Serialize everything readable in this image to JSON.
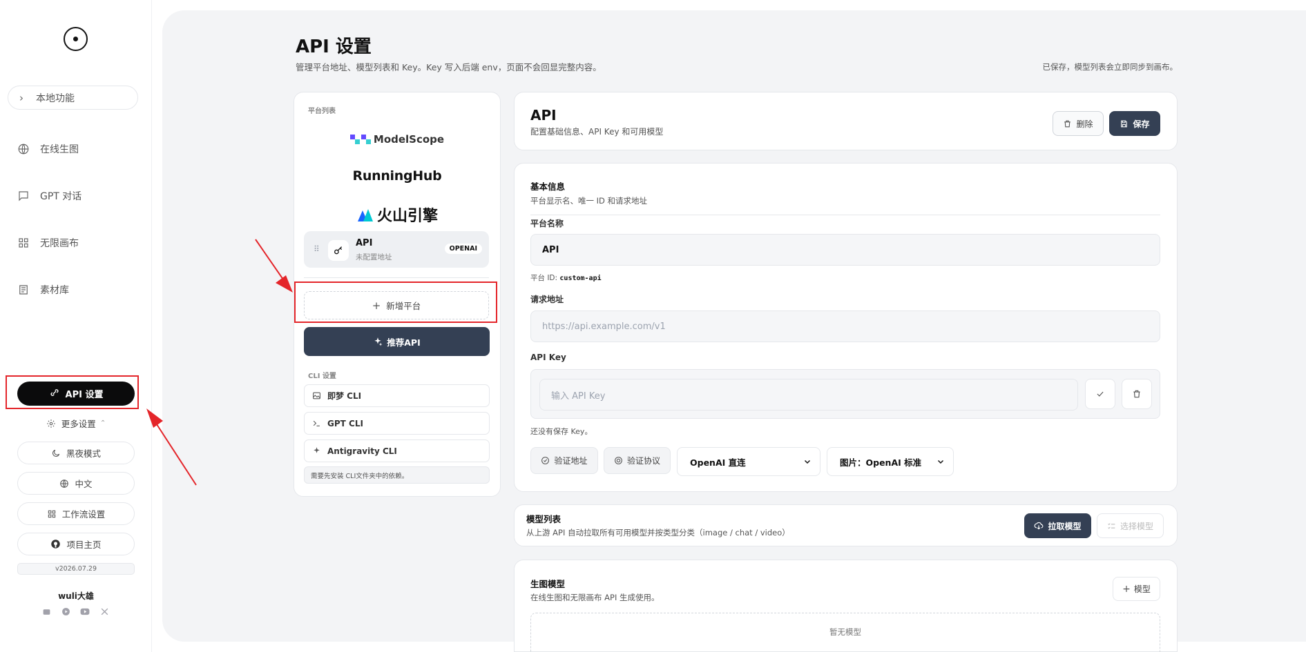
{
  "sidebar": {
    "local_func": "本地功能",
    "nav": [
      {
        "label": "在线生图",
        "icon": "globe-icon"
      },
      {
        "label": "GPT 对话",
        "icon": "chat-icon"
      },
      {
        "label": "无限画布",
        "icon": "grid-icon"
      },
      {
        "label": "素材库",
        "icon": "library-icon"
      }
    ],
    "api_settings": "API 设置",
    "more_settings": "更多设置",
    "dark_mode": "黑夜模式",
    "language": "中文",
    "workflow_settings": "工作流设置",
    "project_home": "项目主页",
    "version": "v2026.07.29",
    "author": "wuli大雄"
  },
  "page": {
    "title": "API 设置",
    "subtitle": "管理平台地址、模型列表和 Key。Key 写入后端 env，页面不会回显完整内容。",
    "saved_note": "已保存，模型列表会立即同步到画布。"
  },
  "platforms": {
    "section_label": "平台列表",
    "brands": [
      "ModelScope",
      "RunningHub",
      "火山引擎"
    ],
    "selected": {
      "name": "API",
      "status": "未配置地址",
      "badge": "OPENAI"
    },
    "add_label": "新增平台",
    "recommend_label": "推荐API"
  },
  "cli": {
    "section_label": "CLI 设置",
    "items": [
      "即梦 CLI",
      "GPT CLI",
      "Antigravity CLI"
    ],
    "note": "需要先安装 CLI文件夹中的依赖。"
  },
  "header": {
    "title": "API",
    "subtitle": "配置基础信息、API Key 和可用模型",
    "delete_label": "删除",
    "save_label": "保存"
  },
  "basic": {
    "title": "基本信息",
    "subtitle": "平台显示名、唯一 ID 和请求地址",
    "name_label": "平台名称",
    "name_value": "API",
    "id_prefix": "平台 ID:",
    "id_value": "custom-api",
    "url_label": "请求地址",
    "url_placeholder": "https://api.example.com/v1",
    "key_label": "API Key",
    "key_placeholder": "输入 API Key",
    "no_key": "还没有保存 Key。",
    "verify_url": "验证地址",
    "verify_protocol": "验证协议",
    "mode_select": "OpenAI 直连",
    "image_select": "图片：OpenAI 标准"
  },
  "models": {
    "title": "模型列表",
    "subtitle": "从上游 API 自动拉取所有可用模型并按类型分类（image / chat / video）",
    "fetch_label": "拉取模型",
    "select_label": "选择模型"
  },
  "gen_models": {
    "title": "生图模型",
    "subtitle": "在线生图和无限画布 API 生成使用。",
    "add_label": "模型",
    "empty": "暂无模型"
  },
  "colors": {
    "accent_dark": "#344054",
    "annotation_red": "#e4252a"
  }
}
